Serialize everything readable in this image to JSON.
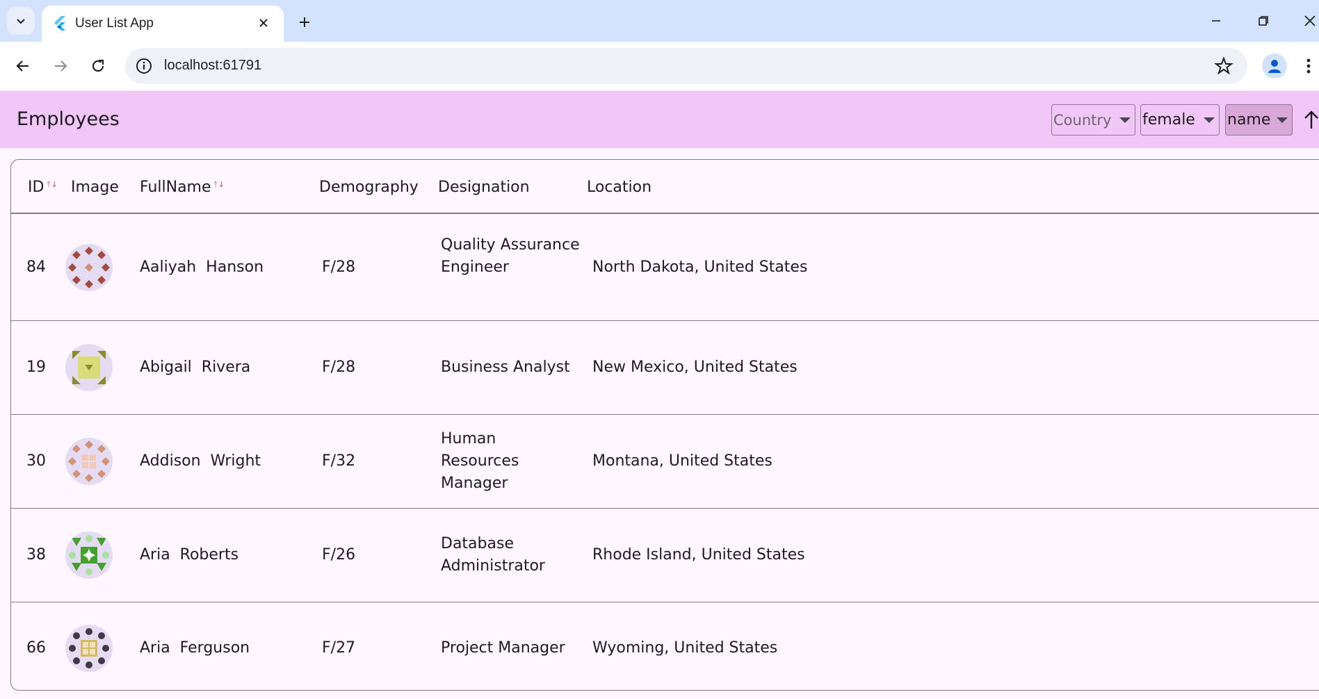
{
  "browser": {
    "tab_title": "User List App",
    "url": "localhost:61791"
  },
  "app": {
    "title": "Employees",
    "filters": {
      "country_placeholder": "Country",
      "gender_value": "female",
      "sort_value": "name"
    }
  },
  "table": {
    "columns": [
      "ID",
      "Image",
      "FullName",
      "Demography",
      "Designation",
      "Location"
    ],
    "rows": [
      {
        "id": "84",
        "name": "Aaliyah  Hanson",
        "demography": "F/28",
        "designation": "Quality Assurance Engineer",
        "location": "North Dakota, United States",
        "avatar": {
          "bg": "#e5dcf3",
          "c1": "#a24b3c",
          "c2": "#d68f72",
          "pattern": "diamonds"
        }
      },
      {
        "id": "19",
        "name": "Abigail  Rivera",
        "demography": "F/28",
        "designation": "Business Analyst",
        "location": "New Mexico, United States",
        "avatar": {
          "bg": "#e5dcf3",
          "c1": "#8c8c2c",
          "c2": "#d8dc7a",
          "pattern": "square"
        }
      },
      {
        "id": "30",
        "name": "Addison  Wright",
        "demography": "F/32",
        "designation": "Human Resources Manager",
        "location": "Montana, United States",
        "avatar": {
          "bg": "#e5dcf3",
          "c1": "#d39476",
          "c2": "#f2c9b4",
          "pattern": "grid"
        }
      },
      {
        "id": "38",
        "name": "Aria  Roberts",
        "demography": "F/26",
        "designation": "Database Administrator",
        "location": "Rhode Island, United States",
        "avatar": {
          "bg": "#e5dcf3",
          "c1": "#46a030",
          "c2": "#a9e2a0",
          "pattern": "star"
        }
      },
      {
        "id": "66",
        "name": "Aria  Ferguson",
        "demography": "F/27",
        "designation": "Project Manager",
        "location": "Wyoming, United States",
        "avatar": {
          "bg": "#e5dcf3",
          "c1": "#3e3a46",
          "c2": "#d6b867",
          "pattern": "dots"
        }
      }
    ]
  },
  "colors": {
    "tabstrip": "#d3e3fd",
    "appbar": "#f0c7f6",
    "page_bg": "#fef7ff",
    "sort_desc_arrow": "#e14a3f"
  },
  "icons": [
    "tab-search-icon",
    "flutter-favicon",
    "close-icon",
    "plus-icon",
    "minimize-icon",
    "restore-icon",
    "back-icon",
    "forward-icon",
    "reload-icon",
    "site-info-icon",
    "bookmark-star-icon",
    "profile-icon",
    "more-icon",
    "sort-ascending-icon"
  ]
}
